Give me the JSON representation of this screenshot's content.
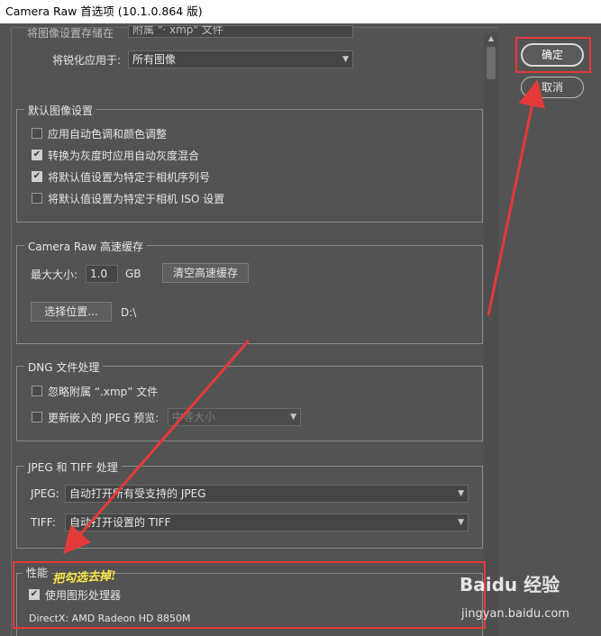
{
  "window": {
    "title": "Camera Raw 首选项 (10.1.0.864 版)"
  },
  "top_section": {
    "partial_label": "将图像设置存储在",
    "partial_value": "附属 \"· xmp\" 文件",
    "sharpen_label": "将锐化应用于:",
    "sharpen_value": "所有图像"
  },
  "default_image": {
    "legend": "默认图像设置",
    "items": [
      {
        "label": "应用自动色调和颜色调整",
        "checked": false
      },
      {
        "label": "转换为灰度时应用自动灰度混合",
        "checked": true
      },
      {
        "label": "将默认值设置为特定于相机序列号",
        "checked": true
      },
      {
        "label": "将默认值设置为特定于相机 ISO 设置",
        "checked": false
      }
    ]
  },
  "cache": {
    "legend": "Camera Raw 高速缓存",
    "max_size_label": "最大大小:",
    "max_size_value": "1.0",
    "unit": "GB",
    "purge_button": "清空高速缓存",
    "location_button": "选择位置...",
    "location_path": "D:\\"
  },
  "dng": {
    "legend": "DNG 文件处理",
    "ignore_label": "忽略附属 “.xmp” 文件",
    "update_label": "更新嵌入的 JPEG 预览:",
    "update_value": "中等大小"
  },
  "jpeg_tiff": {
    "legend": "JPEG 和 TIFF 处理",
    "jpeg_label": "JPEG:",
    "jpeg_value": "自动打开所有受支持的 JPEG",
    "tiff_label": "TIFF:",
    "tiff_value": "自动打开设置的 TIFF"
  },
  "performance": {
    "legend": "性能",
    "gpu_label": "使用图形处理器",
    "gpu_checked": true,
    "directx": "DirectX: AMD Radeon HD 8850M",
    "annotation": "把勾选去掉!"
  },
  "actions": {
    "ok": "确定",
    "cancel": "取消"
  },
  "watermark": {
    "brand": "Baidu 经验",
    "url": "jingyan.baidu.com"
  },
  "colors": {
    "highlight": "#e53a3a",
    "annotation": "#ffe84a"
  }
}
